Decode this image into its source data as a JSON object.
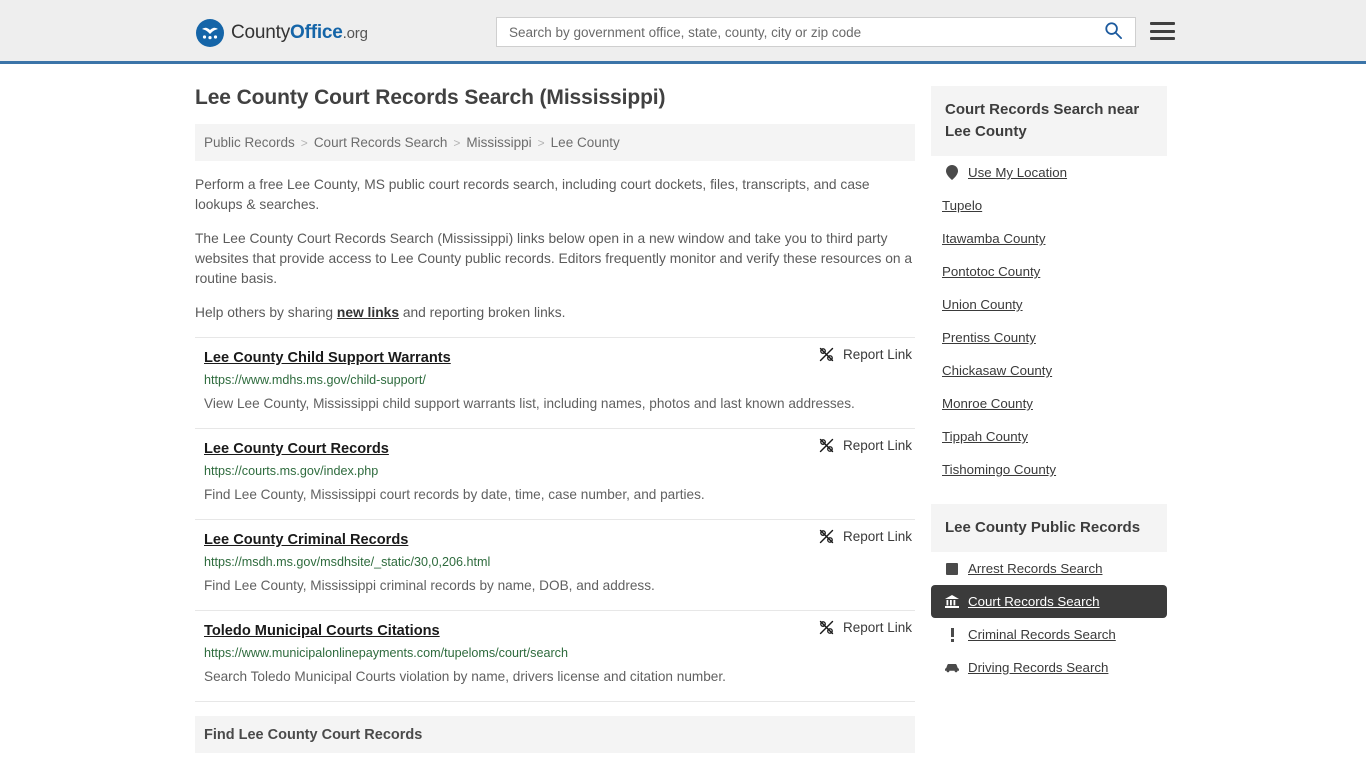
{
  "header": {
    "logo": {
      "name_part1": "County",
      "name_part2": "Office",
      "name_part3": ".org",
      "icon": "eagle-seal-icon"
    },
    "search": {
      "placeholder": "Search by government office, state, county, city or zip code",
      "value": "",
      "icon": "search-icon"
    },
    "menu_icon": "hamburger-menu-icon"
  },
  "main": {
    "title": "Lee County Court Records Search (Mississippi)",
    "breadcrumb": [
      "Public Records",
      "Court Records Search",
      "Mississippi",
      "Lee County"
    ],
    "breadcrumb_separator": ">",
    "intro": {
      "p1": "Perform a free Lee County, MS public court records search, including court dockets, files, transcripts, and case lookups & searches.",
      "p2": "The Lee County Court Records Search (Mississippi) links below open in a new window and take you to third party websites that provide access to Lee County public records. Editors frequently monitor and verify these resources on a routine basis.",
      "p3_before": "Help others by sharing ",
      "p3_link": "new links",
      "p3_after": " and reporting broken links."
    },
    "report_link_label": "Report Link",
    "report_link_icon": "broken-link-icon",
    "results": [
      {
        "title": "Lee County Child Support Warrants",
        "url": "https://www.mdhs.ms.gov/child-support/",
        "description": "View Lee County, Mississippi child support warrants list, including names, photos and last known addresses."
      },
      {
        "title": "Lee County Court Records",
        "url": "https://courts.ms.gov/index.php",
        "description": "Find Lee County, Mississippi court records by date, time, case number, and parties."
      },
      {
        "title": "Lee County Criminal Records",
        "url": "https://msdh.ms.gov/msdhsite/_static/30,0,206.html",
        "description": "Find Lee County, Mississippi criminal records by name, DOB, and address."
      },
      {
        "title": "Toledo Municipal Courts Citations",
        "url": "https://www.municipalonlinepayments.com/tupeloms/court/search",
        "description": "Search Toledo Municipal Courts violation by name, drivers license and citation number."
      }
    ],
    "bottom_section_title": "Find Lee County Court Records"
  },
  "sidebar": {
    "nearby": {
      "heading": "Court Records Search near Lee County",
      "items": [
        {
          "label": "Use My Location",
          "icon": "map-pin-icon"
        },
        {
          "label": "Tupelo",
          "icon": ""
        },
        {
          "label": "Itawamba County",
          "icon": ""
        },
        {
          "label": "Pontotoc County",
          "icon": ""
        },
        {
          "label": "Union County",
          "icon": ""
        },
        {
          "label": "Prentiss County",
          "icon": ""
        },
        {
          "label": "Chickasaw County",
          "icon": ""
        },
        {
          "label": "Monroe County",
          "icon": ""
        },
        {
          "label": "Tippah County",
          "icon": ""
        },
        {
          "label": "Tishomingo County",
          "icon": ""
        }
      ]
    },
    "public_records": {
      "heading": "Lee County Public Records",
      "items": [
        {
          "label": "Arrest Records Search",
          "icon": "square-icon",
          "active": false
        },
        {
          "label": "Court Records Search",
          "icon": "courthouse-icon",
          "active": true
        },
        {
          "label": "Criminal Records Search",
          "icon": "exclamation-icon",
          "active": false
        },
        {
          "label": "Driving Records Search",
          "icon": "car-icon",
          "active": false
        }
      ]
    }
  },
  "colors": {
    "brand_blue": "#1565a8",
    "header_bg": "#eeeeee",
    "header_border": "#3b74a8",
    "url_green": "#2e6b3d",
    "active_bg": "#3b3b3b",
    "panel_gray": "#f4f4f4"
  }
}
